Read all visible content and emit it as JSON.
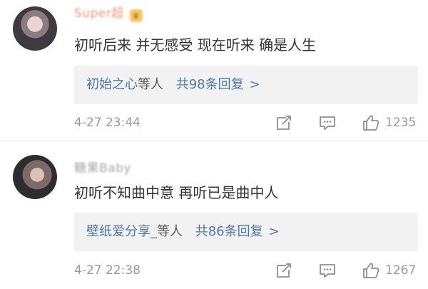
{
  "comments": [
    {
      "username": "Super超",
      "text": "初听后来 并无感受 现在听来 确是人生",
      "reply_users": "初始之心",
      "reply_suffix": "等人",
      "reply_count": "共98条回复",
      "reply_chevron": ">",
      "time": "4-27 23:44",
      "likes": "1235"
    },
    {
      "username": "糖果Baby",
      "text": "初听不知曲中意 再听已是曲中人",
      "reply_users": "壁纸爱分享_",
      "reply_suffix": "等人",
      "reply_count": "共86条回复",
      "reply_chevron": ">",
      "time": "4-27 22:38",
      "likes": "1267"
    }
  ],
  "icons": {
    "share": "share-icon",
    "comment": "comment-icon",
    "like": "thumbs-up-icon"
  },
  "colors": {
    "link": "#4b78a7",
    "text": "#333333",
    "meta": "#9a9a9a",
    "reply_bg": "#f2f2f2"
  }
}
